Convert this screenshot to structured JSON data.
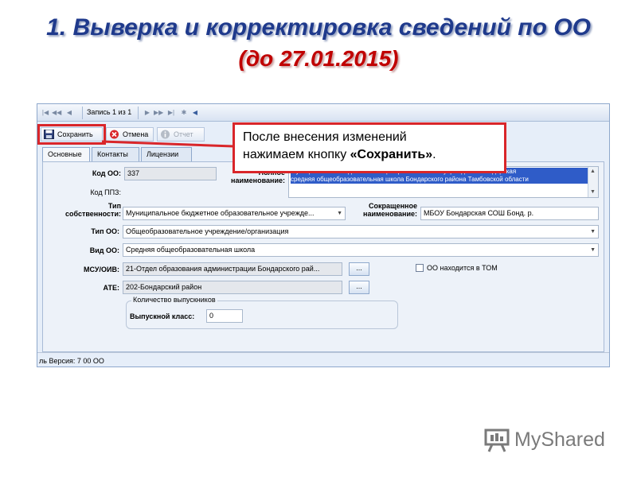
{
  "slide": {
    "title_line1": "1. Выверка и корректировка сведений по ОО",
    "title_line2": "(до 27.01.2015)"
  },
  "navigator": {
    "record_label": "Запись 1 из 1"
  },
  "toolbar": {
    "save_label": "Сохранить",
    "cancel_label": "Отмена",
    "report_label": "Отчет"
  },
  "tabs": [
    {
      "label": "Основные",
      "active": true
    },
    {
      "label": "Контакты",
      "active": false
    },
    {
      "label": "Лицензии",
      "active": false
    }
  ],
  "form": {
    "code_oo_label": "Код ОО:",
    "code_oo_value": "337",
    "code_ppz_label": "Код ППЗ:",
    "full_name_label_line1": "Полное",
    "full_name_label_line2": "наименование:",
    "full_name_line1": "Муниципальное бюджетное общеобразовательное учреждение Бондарская",
    "full_name_line2": "средняя общеобразовательная школа Бондарского района Тамбовской области",
    "ownership_label_line1": "Тип",
    "ownership_label_line2": "собственности:",
    "ownership_value": "Муниципальное бюджетное образовательное учрежде...",
    "short_name_label_line1": "Сокращенное",
    "short_name_label_line2": "наименование:",
    "short_name_value": "МБОУ Бондарская СОШ Бонд. р.",
    "type_oo_label": "Тип ОО:",
    "type_oo_value": "Общеобразовательное учреждение/организация",
    "kind_oo_label": "Вид ОО:",
    "kind_oo_value": "Средняя общеобразовательная школа",
    "msu_label": "МСУ/ОИВ:",
    "msu_value": "21-Отдел образования администрации Бондарского рай...",
    "ate_label": "АТЕ:",
    "ate_value": "202-Бондарский район",
    "browse_label": "...",
    "in_tom_label": "ОО находится в ТОМ",
    "in_tom_checked": false,
    "graduates_group_title": "Количество выпускников",
    "grad_class_label": "Выпускной класс:",
    "grad_class_value": "0"
  },
  "statusbar": {
    "version_text": "ль Версия: 7 00  ОО"
  },
  "callout": {
    "text_line1": "После внесения изменений",
    "text_line2_prefix": "нажимаем кнопку ",
    "text_line2_bold": "«Сохранить»",
    "text_line2_suffix": "."
  },
  "logo": {
    "text": "MyShared"
  },
  "colors": {
    "title": "#1f3a8c",
    "date": "#c00000",
    "highlight": "#d9262a",
    "selection": "#2f5cc8"
  }
}
